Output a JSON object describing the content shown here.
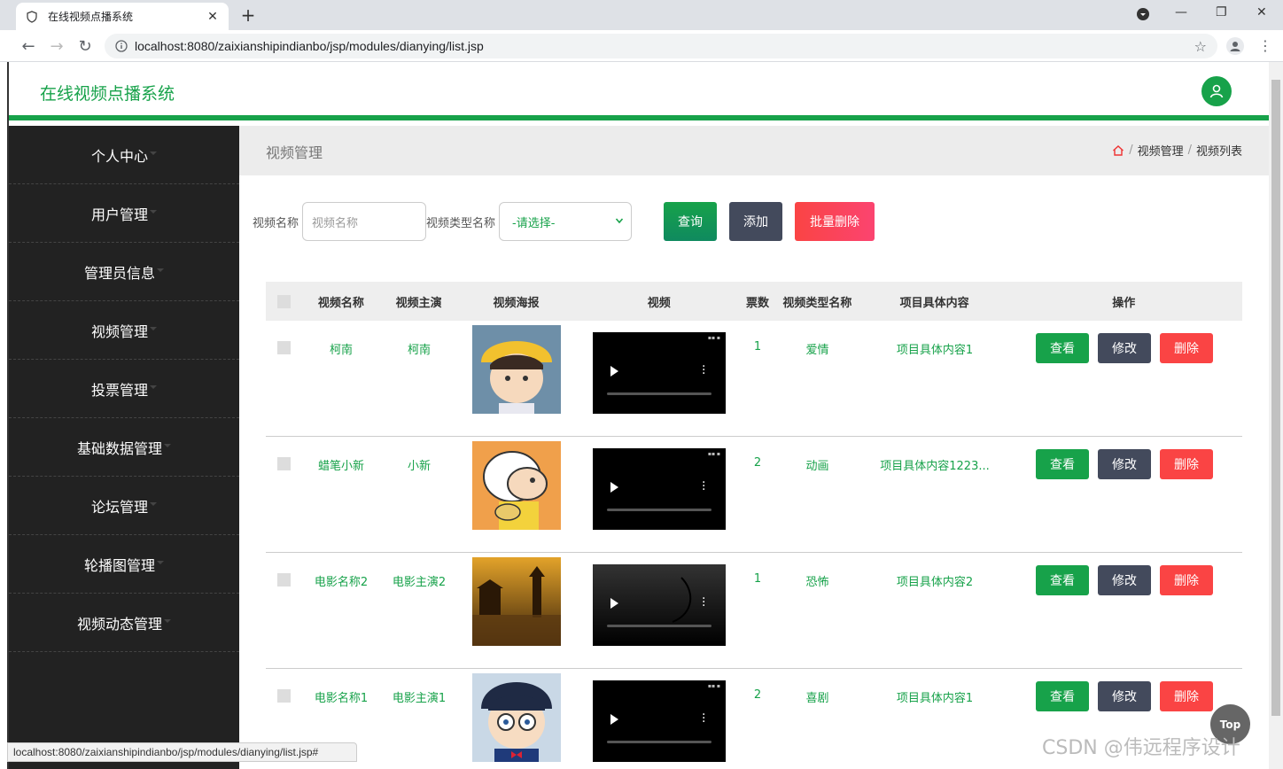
{
  "browser": {
    "tab_title": "在线视频点播系统",
    "url": "localhost:8080/zaixianshipindianbo/jsp/modules/dianying/list.jsp",
    "status_url": "localhost:8080/zaixianshipindianbo/jsp/modules/dianying/list.jsp#"
  },
  "header": {
    "brand": "在线视频点播系统"
  },
  "sidebar": {
    "items": [
      {
        "label": "个人中心"
      },
      {
        "label": "用户管理"
      },
      {
        "label": "管理员信息"
      },
      {
        "label": "视频管理"
      },
      {
        "label": "投票管理"
      },
      {
        "label": "基础数据管理"
      },
      {
        "label": "论坛管理"
      },
      {
        "label": "轮播图管理"
      },
      {
        "label": "视频动态管理"
      }
    ]
  },
  "breadcrumb": {
    "page_title": "视频管理",
    "path": [
      "视频管理",
      "视频列表"
    ],
    "separator": "/"
  },
  "search": {
    "name_label": "视频名称",
    "name_placeholder": "视频名称",
    "type_label": "视频类型名称",
    "type_selected": "-请选择-",
    "query_btn": "查询",
    "add_btn": "添加",
    "batch_delete_btn": "批量删除"
  },
  "table": {
    "headers": [
      "视频名称",
      "视频主演",
      "视频海报",
      "视频",
      "票数",
      "视频类型名称",
      "项目具体内容",
      "操作"
    ],
    "actions": {
      "view": "查看",
      "edit": "修改",
      "delete": "删除"
    },
    "rows": [
      {
        "name": "柯南",
        "actor": "柯南",
        "votes": "1",
        "type": "爱情",
        "content": "项目具体内容1",
        "poster": "conan-yellow-hat"
      },
      {
        "name": "蜡笔小新",
        "actor": "小新",
        "votes": "2",
        "type": "动画",
        "content": "项目具体内容1223...",
        "poster": "shinchan"
      },
      {
        "name": "电影名称2",
        "actor": "电影主演2",
        "votes": "1",
        "type": "恐怖",
        "content": "项目具体内容2",
        "poster": "pagoda-sunset"
      },
      {
        "name": "电影名称1",
        "actor": "电影主演1",
        "votes": "2",
        "type": "喜剧",
        "content": "项目具体内容1",
        "poster": "conan-glasses"
      }
    ]
  },
  "floating": {
    "top_btn": "Top",
    "watermark": "CSDN @伟远程序设计"
  },
  "colors": {
    "primary": "#17a24a",
    "dark": "#434a5c",
    "danger": "#fa4444",
    "sidebar": "#222222"
  }
}
